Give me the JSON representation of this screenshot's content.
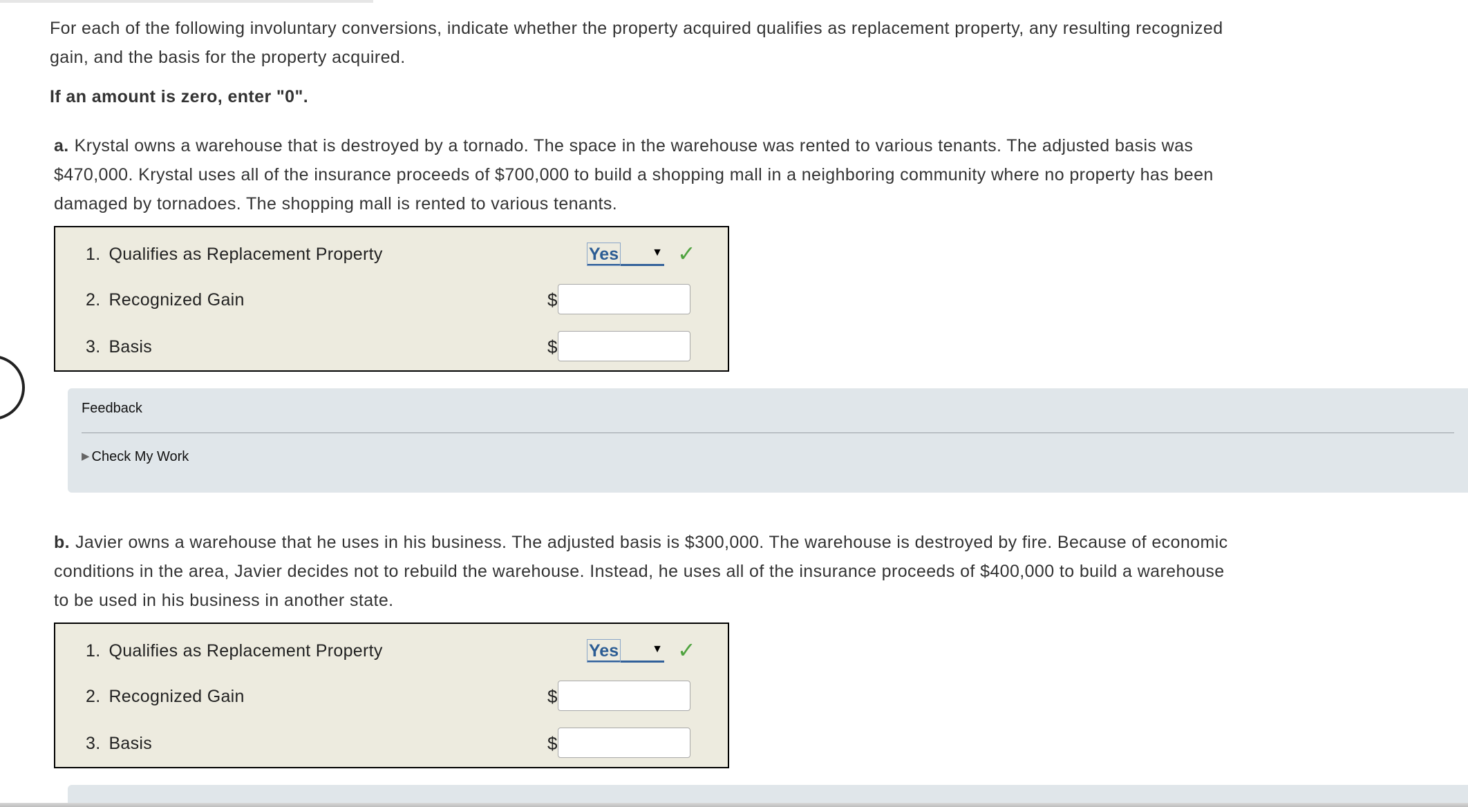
{
  "intro": "For each of the following involuntary conversions, indicate whether the property acquired qualifies as replacement property, any resulting recognized gain, and the basis for the property acquired.",
  "instruction": "If an amount is zero, enter \"0\".",
  "parts": [
    {
      "letter": "a.",
      "text": "Krystal owns a warehouse that is destroyed by a tornado. The space in the warehouse was rented to various tenants. The adjusted basis was $470,000. Krystal uses all of the insurance proceeds of $700,000 to build a shopping mall in a neighboring community where no property has been damaged by tornadoes. The shopping mall is rented to various tenants.",
      "rows": [
        {
          "num": "1.",
          "label": "Qualifies as Replacement Property",
          "selected": "Yes"
        },
        {
          "num": "2.",
          "label": "Recognized Gain",
          "currency": "$",
          "value": ""
        },
        {
          "num": "3.",
          "label": "Basis",
          "currency": "$",
          "value": ""
        }
      ],
      "feedback": {
        "title": "Feedback",
        "check_label": "Check My Work"
      }
    },
    {
      "letter": "b.",
      "text": "Javier owns a warehouse that he uses in his business. The adjusted basis is $300,000. The warehouse is destroyed by fire. Because of economic conditions in the area, Javier decides not to rebuild the warehouse. Instead, he uses all of the insurance proceeds of $400,000 to build a warehouse to be used in his business in another state.",
      "rows": [
        {
          "num": "1.",
          "label": "Qualifies as Replacement Property",
          "selected": "Yes"
        },
        {
          "num": "2.",
          "label": "Recognized Gain",
          "currency": "$",
          "value": ""
        },
        {
          "num": "3.",
          "label": "Basis",
          "currency": "$",
          "value": ""
        }
      ]
    }
  ],
  "icons": {
    "check": "checkmark-icon",
    "dropdown": "dropdown-arrow-icon",
    "expand": "expand-triangle-icon"
  },
  "colors": {
    "check": "#4fa33f",
    "select_text": "#2c5d94",
    "answer_bg": "#edebdf",
    "feedback_bg": "#e0e6ea"
  }
}
